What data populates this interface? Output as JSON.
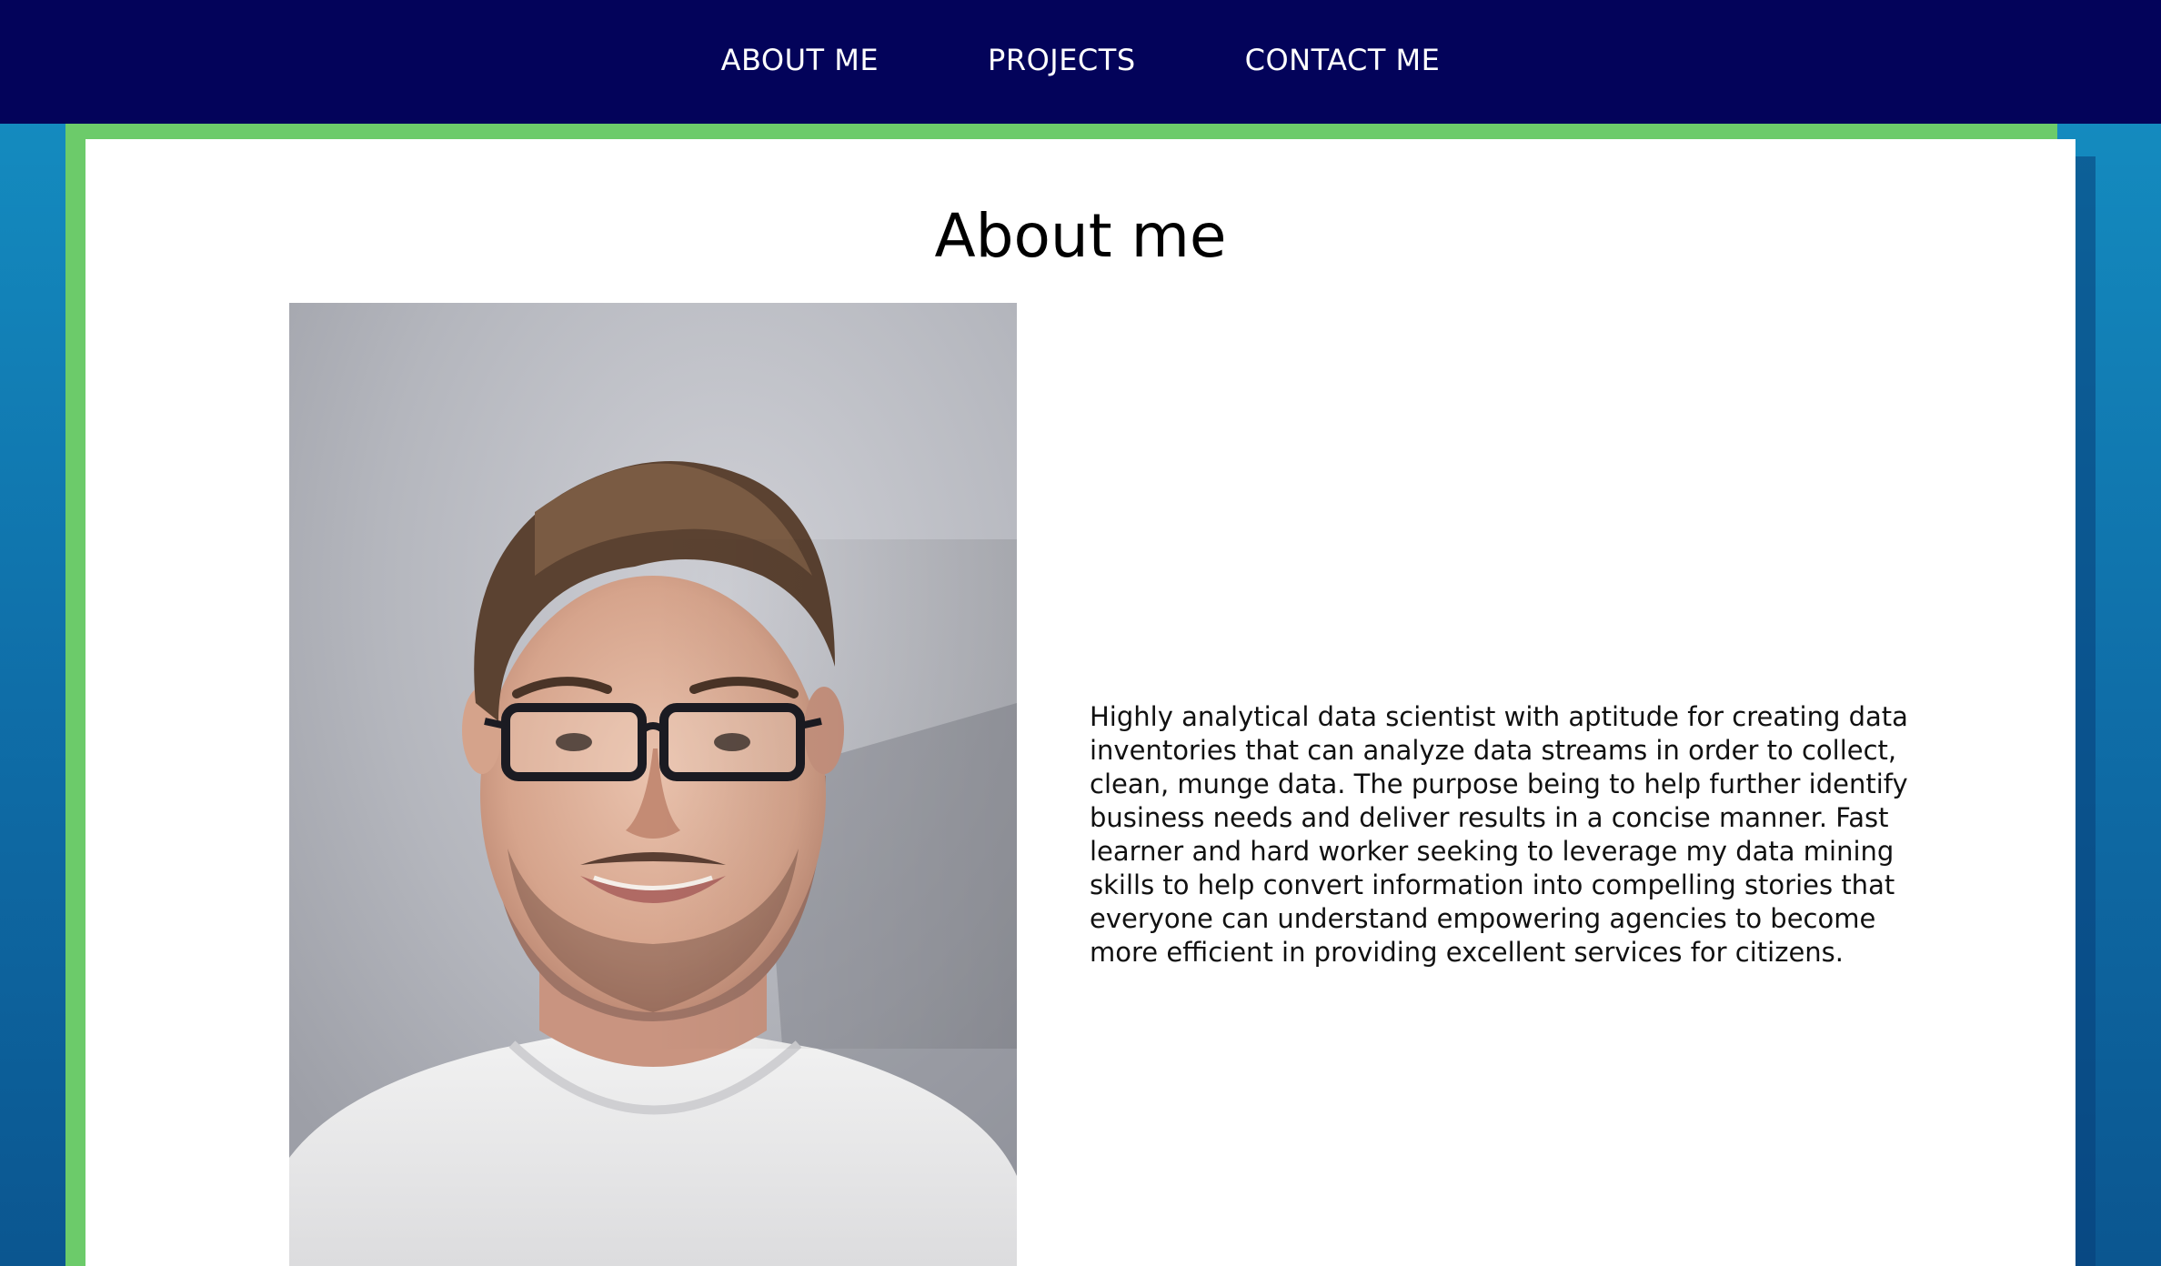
{
  "nav": {
    "items": [
      {
        "label": "ABOUT ME"
      },
      {
        "label": "PROJECTS"
      },
      {
        "label": "CONTACT ME"
      }
    ]
  },
  "about": {
    "title": "About me",
    "bio": "Highly analytical data scientist with aptitude for creating data inventories that can analyze data streams in order to collect, clean, munge data. The purpose being to help further identify business needs and deliver results in a concise manner. Fast learner and hard worker seeking to leverage my data mining skills to help convert information into compelling stories that everyone can understand empowering agencies to become more efficient in providing excellent services for citizens."
  },
  "colors": {
    "navbar": "#03035a",
    "frame_green": "#6ccb6a",
    "background_blue": "#1591c4",
    "card": "#ffffff"
  }
}
